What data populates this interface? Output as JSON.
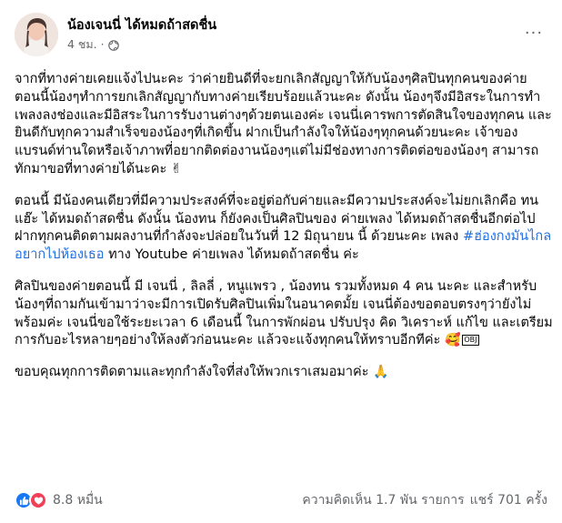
{
  "post": {
    "author": "น้องเจนนี่ ได้หมดถ้าสดชื่น",
    "time": "4 ชม.",
    "dot": "·",
    "more_label": "···",
    "paragraphs": [
      "จากที่ทางค่ายเคยแจ้งไปนะคะ ว่าค่ายยินดีที่จะยกเลิกสัญญาให้กับน้องๆศิลปินทุกคนของค่าย ตอนนี้น้องๆทำการยกเลิกสัญญากับทางค่ายเรียบร้อยแล้วนะคะ ดังนั้น น้องๆจึงมีอิสระในการทำเพลงลงช่องและมีอิสระในการรับงานต่างๆด้วยตนเองค่ะ เจนนี่เคารพการตัดสินใจของทุกคน และยินดีกับทุกความสำเร็จของน้องๆที่เกิดขึ้น ฝากเป็นกำลังใจให้น้องๆทุกคนด้วยนะคะ เจ้าของแบรนด์ท่านใดหรือเจ้าภาพที่อยากติดต่องานน้องๆแต่ไม่มีช่องทางการติดต่อของน้องๆ สามารถทักมาขอที่ทางค่ายได้นะคะ ✌",
      "ตอนนี้ มีน้องคนเดียวที่มีความประสงค์ที่จะอยู่ต่อกับค่ายและมีความประสงค์จะไม่ยกเลิกคือ ทน แฮ๊ะ ได้หมดถ้าสดชื่น ดังนั้น น้องทน ก็ยังคงเป็นศิลปินของ ค่ายเพลง ได้หมดถ้าสดชื่นอีกต่อไป ฝากทุกคนติดตามผลงานที่กำลังจะปล่อยในวันที่ 12 มิถุนายน นี้ ด้วยนะคะ เพลง ",
      "ศิลปินของค่ายตอนนี้ มี เจนนี่ , ลิลลี่ , หนูแพรว , น้องทน รวมทั้งหมด 4 คน นะคะ และสำหรับน้องๆที่ถามกันเข้ามาว่าจะมีการเปิดรับศิลปินเพิ่มในอนาคตมั้ย เจนนี่ต้องขอตอบตรงๆว่ายังไม่พร้อมค่ะ เจนนี่ขอใช้ระยะเวลา 6 เดือนนี้ ในการพักผ่อน ปรับปรุง คิด วิเคราะห์ แก้ไข และเตรียมการกับอะไรหลายๆอย่างให้ลงตัวก่อนนะคะ แล้วจะแจ้งทุกคนให้ทราบอีกทีค่ะ ",
      "ขอบคุณทุกการติดตามและทุกกำลังใจที่ส่งให้พวกเราเสมอมาค่ะ "
    ],
    "hashtag": "#ฮ่องกงมันไกลอยากไปห้องเธอ",
    "after_hashtag": " ทาง Youtube ค่ายเพลง ได้หมดถ้าสดชื่น ค่ะ",
    "emoji_love": "🥰",
    "emoji_obj": "OBJ",
    "emoji_pray": "🙏",
    "reaction_count": "8.8 หมื่น",
    "comments": "ความคิดเห็น 1.7 พัน รายการ",
    "shares": "แชร์ 701 ครั้ง"
  },
  "colors": {
    "accent": "#1877f2",
    "love": "#f33e58",
    "hashtag": "#216fdb",
    "secondary_text": "#65676b"
  },
  "icons": [
    "avatar",
    "globe-icon",
    "more-icon",
    "like-icon",
    "love-icon"
  ]
}
